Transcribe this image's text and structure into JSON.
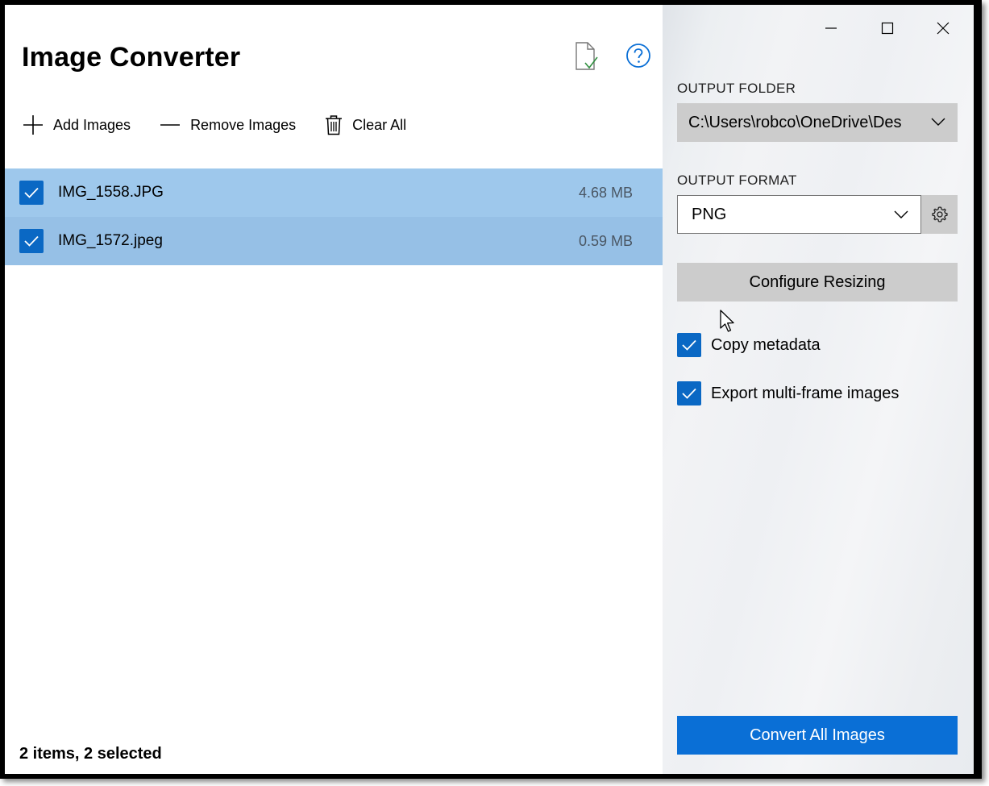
{
  "app": {
    "title": "Image Converter"
  },
  "header_icons": {
    "file_check": "file-check-icon",
    "help": "help-icon"
  },
  "toolbar": {
    "add_label": "Add Images",
    "remove_label": "Remove Images",
    "clear_label": "Clear All"
  },
  "files": [
    {
      "name": "IMG_1558.JPG",
      "size": "4.68 MB",
      "checked": true
    },
    {
      "name": "IMG_1572.jpeg",
      "size": "0.59 MB",
      "checked": true
    }
  ],
  "status": {
    "text": "2 items, 2 selected"
  },
  "output": {
    "folder_label": "OUTPUT FOLDER",
    "folder_value": "C:\\Users\\robco\\OneDrive\\Des",
    "format_label": "OUTPUT FORMAT",
    "format_value": "PNG"
  },
  "actions": {
    "configure_resizing": "Configure Resizing",
    "convert": "Convert All Images"
  },
  "options": {
    "copy_metadata": {
      "label": "Copy metadata",
      "checked": true
    },
    "export_multiframe": {
      "label": "Export multi-frame images",
      "checked": true
    }
  },
  "colors": {
    "accent": "#0a6fd6",
    "checkbox": "#0a68c4",
    "row_selected_1": "#9ec8ec",
    "row_selected_2": "#96c0e6",
    "neutral_button": "#cccccc"
  }
}
